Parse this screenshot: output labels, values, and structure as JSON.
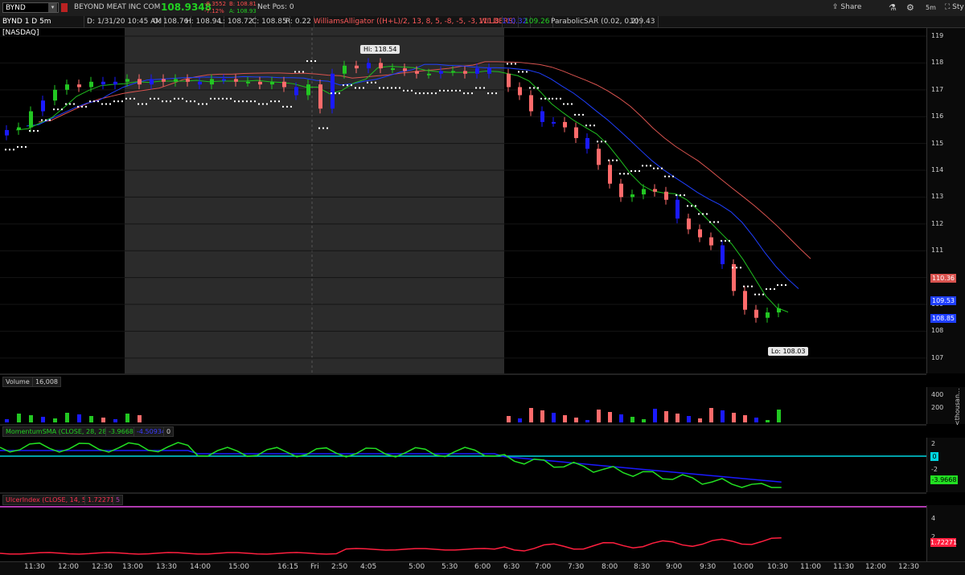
{
  "toolbar": {
    "symbol": "BYND",
    "company": "BEYOND MEAT INC COM",
    "last_price": "108.9348",
    "change": "-8.3552",
    "change_pct": "-7.12%",
    "bid": "B: 108.81",
    "ask": "A: 108.93",
    "net_pos": "Net Pos: 0",
    "share_label": "Share",
    "timeframe": "5m",
    "style_label": "Sty"
  },
  "info": {
    "title": "BYND 1 D 5m [NASDAQ]",
    "date": "D: 1/31/20 10:45 AM",
    "open": "O: 108.76",
    "high": "H: 108.94",
    "low": "L: 108.72",
    "close": "C: 108.85",
    "range": "R: 0.22",
    "alligator_label": "WilliamsAlligator ((H+L)/2, 13, 8, 5, -8, -5, -3, WILDERS)",
    "alligator_v1": "111.8",
    "alligator_v2": "110.32",
    "alligator_v3": "109.26",
    "sar_label": "ParabolicSAR (0.02, 0.2)",
    "sar_value": "109.43"
  },
  "price_axis": [
    "119",
    "118",
    "117",
    "116",
    "115",
    "114",
    "113",
    "112",
    "111",
    "110",
    "109",
    "108",
    "107"
  ],
  "price_tags": {
    "jaw": "110.36",
    "teeth": "109.53",
    "lips": "108.85"
  },
  "callouts": {
    "hi": "Hi: 118.54",
    "lo": "Lo: 108.03"
  },
  "volume": {
    "label": "Volume",
    "value": "16,008",
    "axis": [
      "400",
      "200"
    ],
    "unit": "<thousan..."
  },
  "momentum": {
    "label": "MomentumSMA (CLOSE, 28, 28)",
    "v1": "-3.9668",
    "v2": "-4.50934",
    "v3": "0",
    "axis": [
      "2",
      "-2"
    ],
    "zero_tag": "0",
    "tag": "-3.9668"
  },
  "ulcer": {
    "label": "UlcerIndex (CLOSE, 14, 5)",
    "v1": "1.72271",
    "v2": "5",
    "axis": [
      "4",
      "2"
    ],
    "tag": "1.72271"
  },
  "time_axis": [
    "11:30",
    "12:00",
    "12:30",
    "13:00",
    "13:30",
    "14:00",
    "15:00",
    "16:15",
    "Fri",
    "2:50",
    "4:05",
    "5:00",
    "5:30",
    "6:00",
    "6:30",
    "7:00",
    "7:30",
    "8:00",
    "8:30",
    "9:00",
    "9:30",
    "10:00",
    "10:30",
    "11:00",
    "11:30",
    "12:00",
    "12:30"
  ],
  "colors": {
    "up": "#22c722",
    "down": "#ff6b6b",
    "blue": "#1a1aff",
    "jaw": "#d9534f",
    "teeth": "#1f3fff",
    "lips": "#1fbf1f",
    "cyan": "#00d5e0",
    "magenta": "#b03ab0"
  },
  "chart_data": {
    "type": "candlestick",
    "price_range": [
      107,
      119
    ],
    "closes": [
      115.5,
      115.6,
      116.2,
      116.6,
      117.0,
      117.2,
      117.1,
      117.3,
      117.2,
      117.3,
      117.4,
      117.2,
      117.4,
      117.3,
      117.4,
      117.3,
      117.2,
      117.4,
      117.4,
      117.3,
      117.3,
      117.2,
      117.3,
      117.1,
      116.8,
      117.2,
      116.3,
      117.6,
      117.9,
      117.8,
      118.0,
      117.8,
      117.8,
      117.7,
      117.6,
      117.6,
      117.7,
      117.7,
      117.6,
      117.8,
      117.6,
      117.1,
      116.8,
      116.2,
      115.8,
      115.8,
      115.6,
      115.2,
      114.8,
      114.2,
      113.5,
      113.0,
      113.1,
      113.3,
      113.2,
      112.9,
      112.2,
      111.8,
      111.5,
      111.2,
      110.5,
      109.5,
      108.8,
      108.5,
      108.7,
      108.85
    ]
  }
}
